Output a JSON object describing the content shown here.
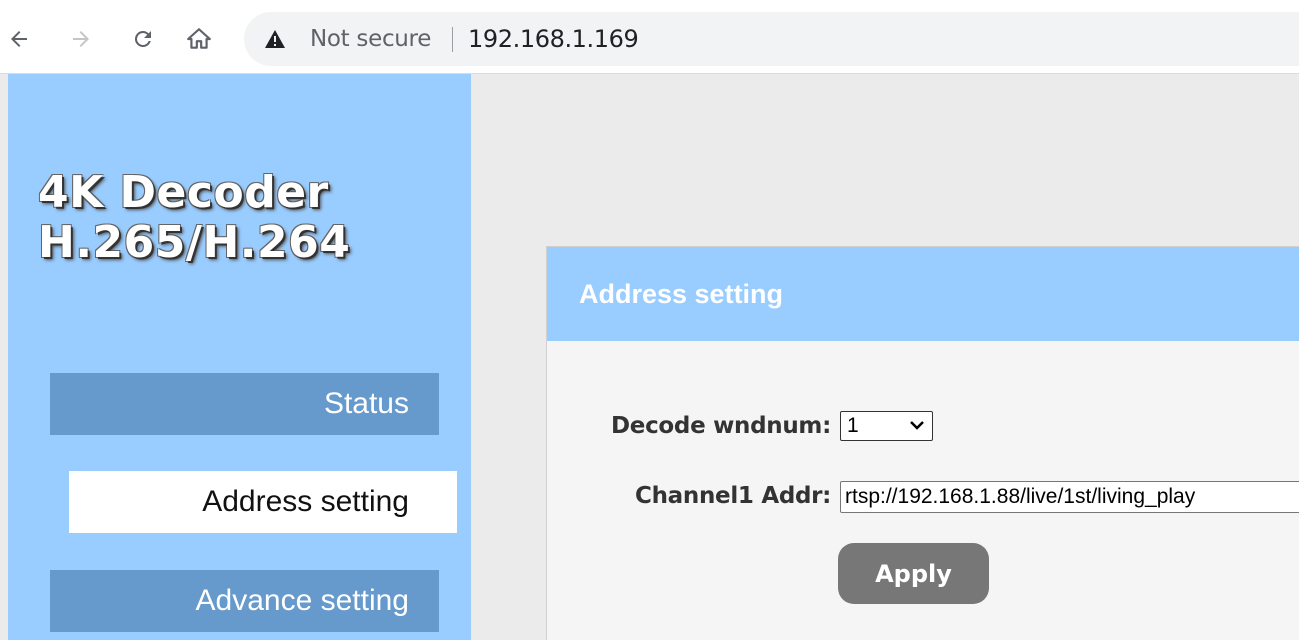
{
  "browser": {
    "security_label": "Not secure",
    "url": "192.168.1.169"
  },
  "brand": {
    "line1": "4K Decoder",
    "line2": "H.265/H.264"
  },
  "sidebar": {
    "items": [
      {
        "label": "Status"
      },
      {
        "label": "Address setting"
      },
      {
        "label": "Advance setting"
      }
    ]
  },
  "panel": {
    "title": "Address setting",
    "decode_wndnum_label": "Decode wndnum:",
    "decode_wndnum_value": "1",
    "channel1_label": "Channel1 Addr:",
    "channel1_value": "rtsp://192.168.1.88/live/1st/living_play",
    "apply_label": "Apply"
  },
  "colors": {
    "sidebar_bg": "#99ccff",
    "menu_item_bg": "#6699cc",
    "button_bg": "#777777"
  }
}
